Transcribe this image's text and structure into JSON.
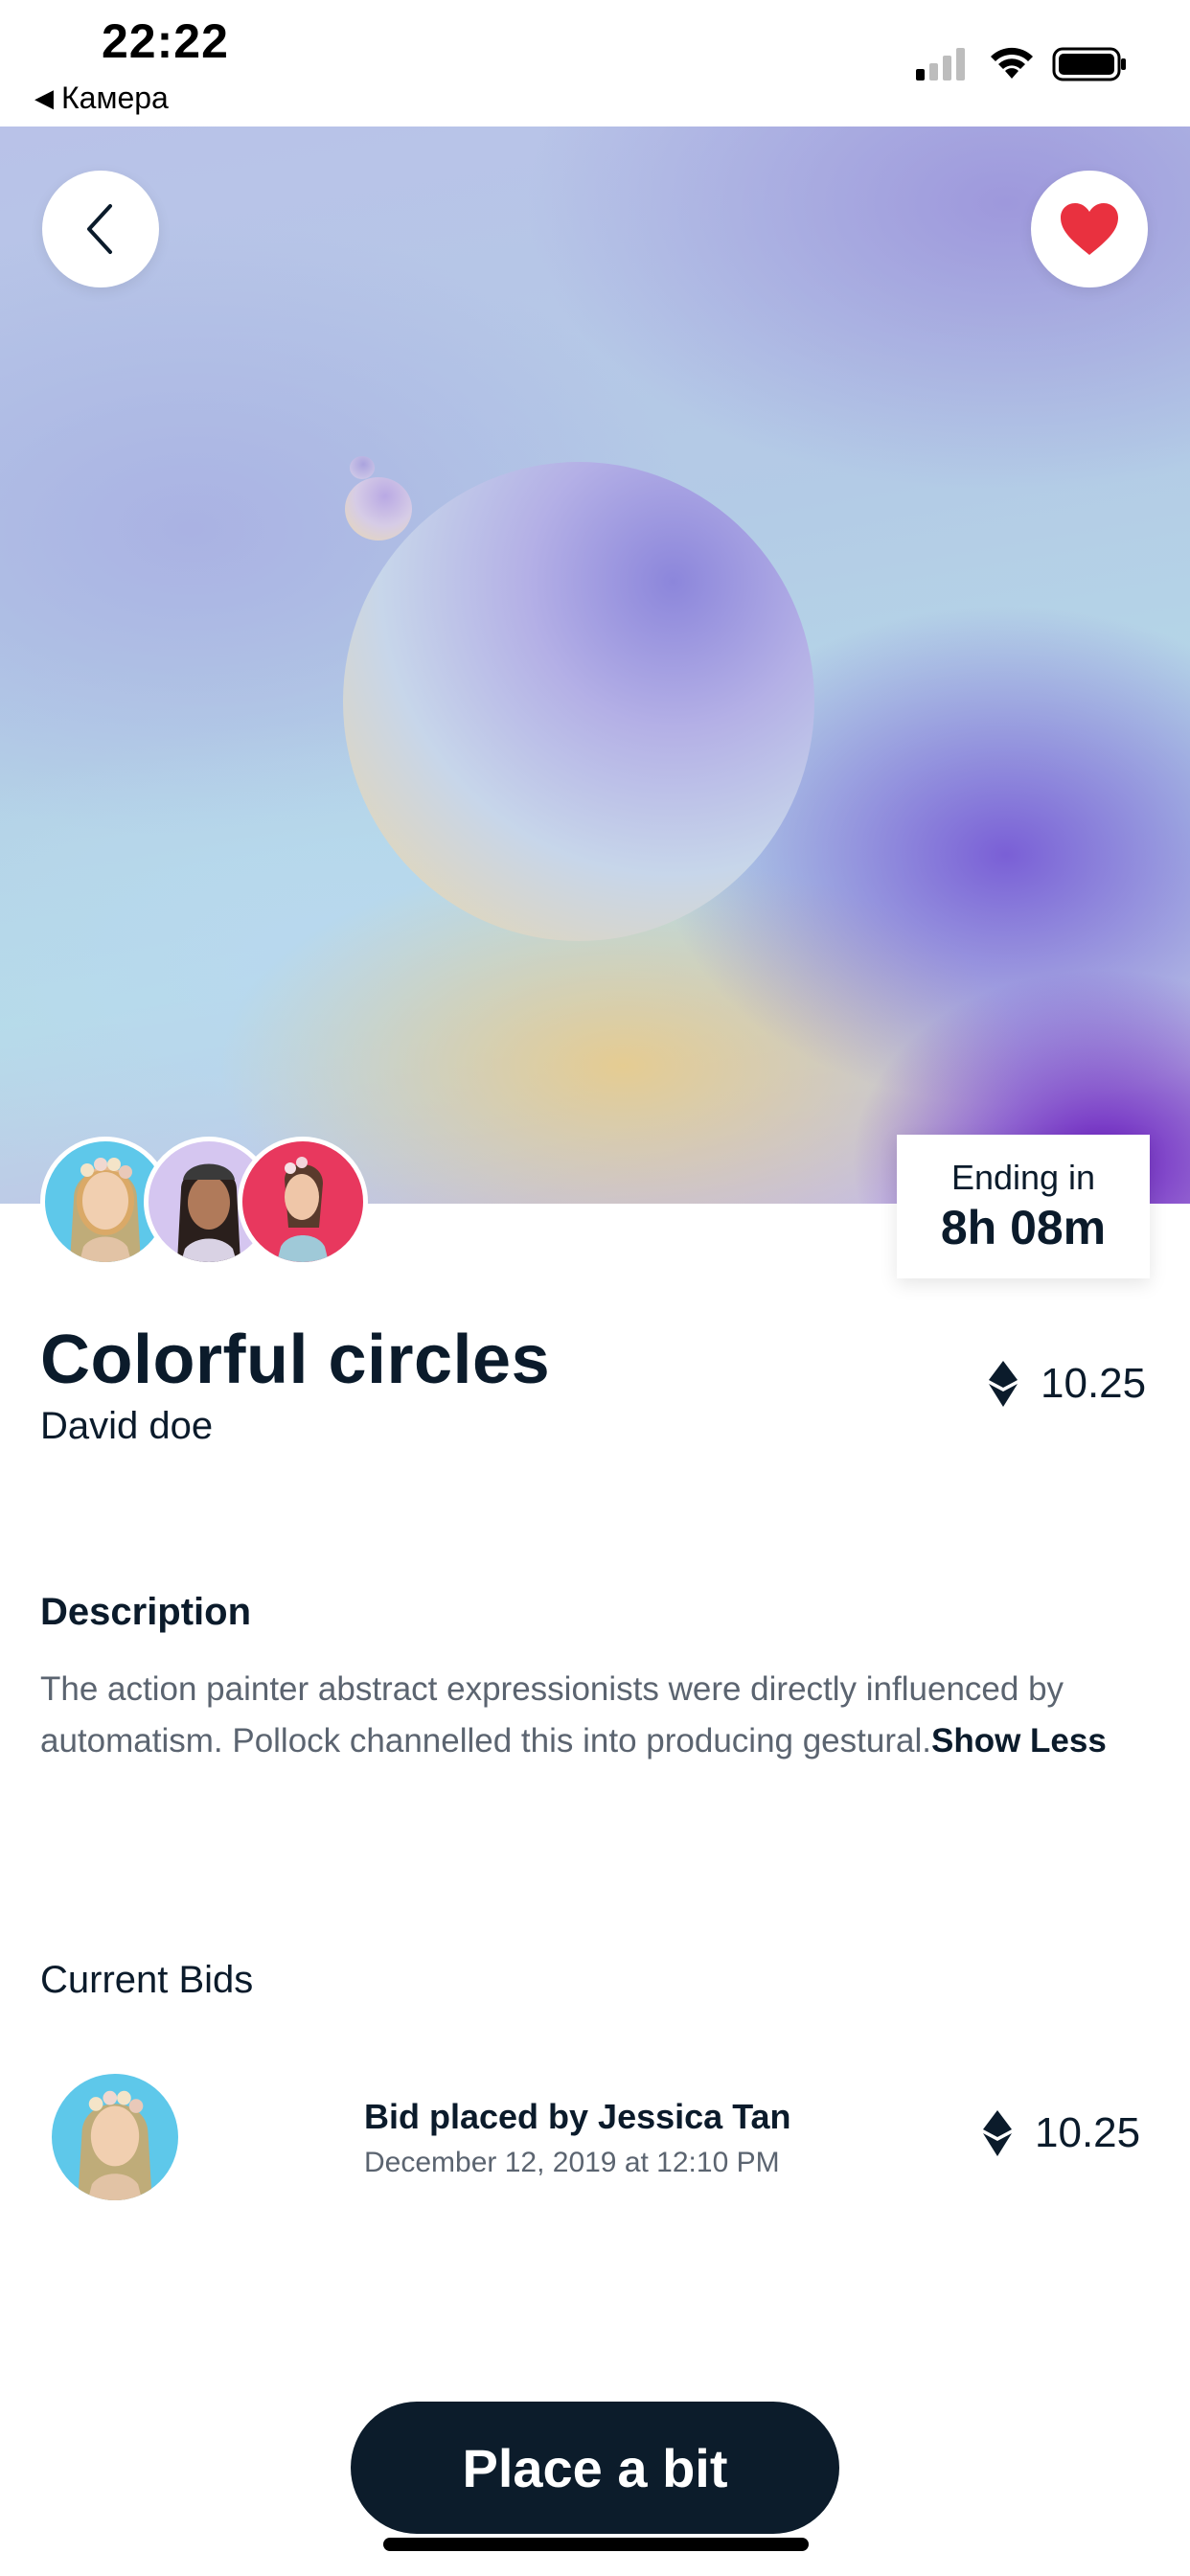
{
  "status_bar": {
    "time": "22:22",
    "back_app": "Камера",
    "back_app_icon": "back-triangle-icon"
  },
  "hero": {
    "back_icon": "chevron-left-icon",
    "favorite_icon": "heart-icon",
    "favorite_color": "#e9313f"
  },
  "auction": {
    "ending_label": "Ending in",
    "ending_value": "8h 08m"
  },
  "artwork": {
    "title": "Colorful circles",
    "author": "David doe",
    "price": "10.25",
    "currency_icon": "ethereum-icon"
  },
  "description": {
    "heading": "Description",
    "body": "The action painter abstract expressionists were directly influenced by automatism. Pollock channelled this into producing gestural.",
    "toggle_label": "Show Less"
  },
  "bids": {
    "heading": "Current Bids",
    "items": [
      {
        "title": "Bid placed by Jessica Tan",
        "date": "December 12, 2019 at 12:10 PM",
        "amount": "10.25"
      }
    ]
  },
  "cta": {
    "label": "Place a bit",
    "color": "#0c1c2b"
  }
}
